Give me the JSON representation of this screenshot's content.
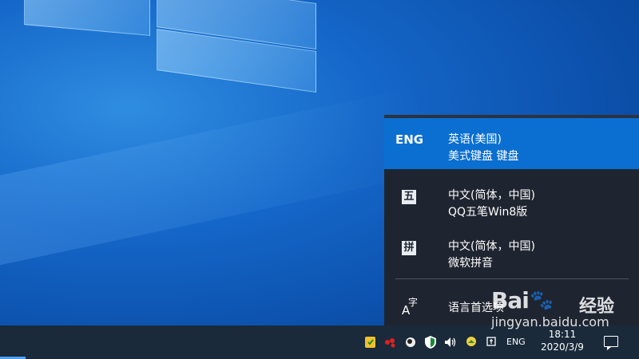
{
  "languages": [
    {
      "code": "ENG",
      "name": "英语(美国)",
      "keyboard": "美式键盘 键盘",
      "active": true
    },
    {
      "code": "五",
      "name": "中文(简体，中国)",
      "keyboard": "QQ五笔Win8版",
      "active": false
    },
    {
      "code": "拼",
      "name": "中文(简体，中国)",
      "keyboard": "微软拼音",
      "active": false
    }
  ],
  "preferences": {
    "icon_a": "A",
    "icon_zi": "字",
    "label": "语言首选项"
  },
  "taskbar": {
    "ime": "ENG",
    "time": "18:11",
    "date": "2020/3/9",
    "tray_icons": [
      "shield-app-icon",
      "chat-app-icon",
      "network-app-icon",
      "security-shield-icon",
      "volume-icon",
      "weather-app-icon",
      "ime-mode-icon"
    ]
  },
  "watermark": {
    "brand": "Bai",
    "brand2": "经验",
    "url": "jingyan.baidu.com"
  },
  "colors": {
    "accent": "#0a6fd0",
    "flyout_bg": "#1f2530",
    "taskbar_bg": "#1a2a3a"
  }
}
